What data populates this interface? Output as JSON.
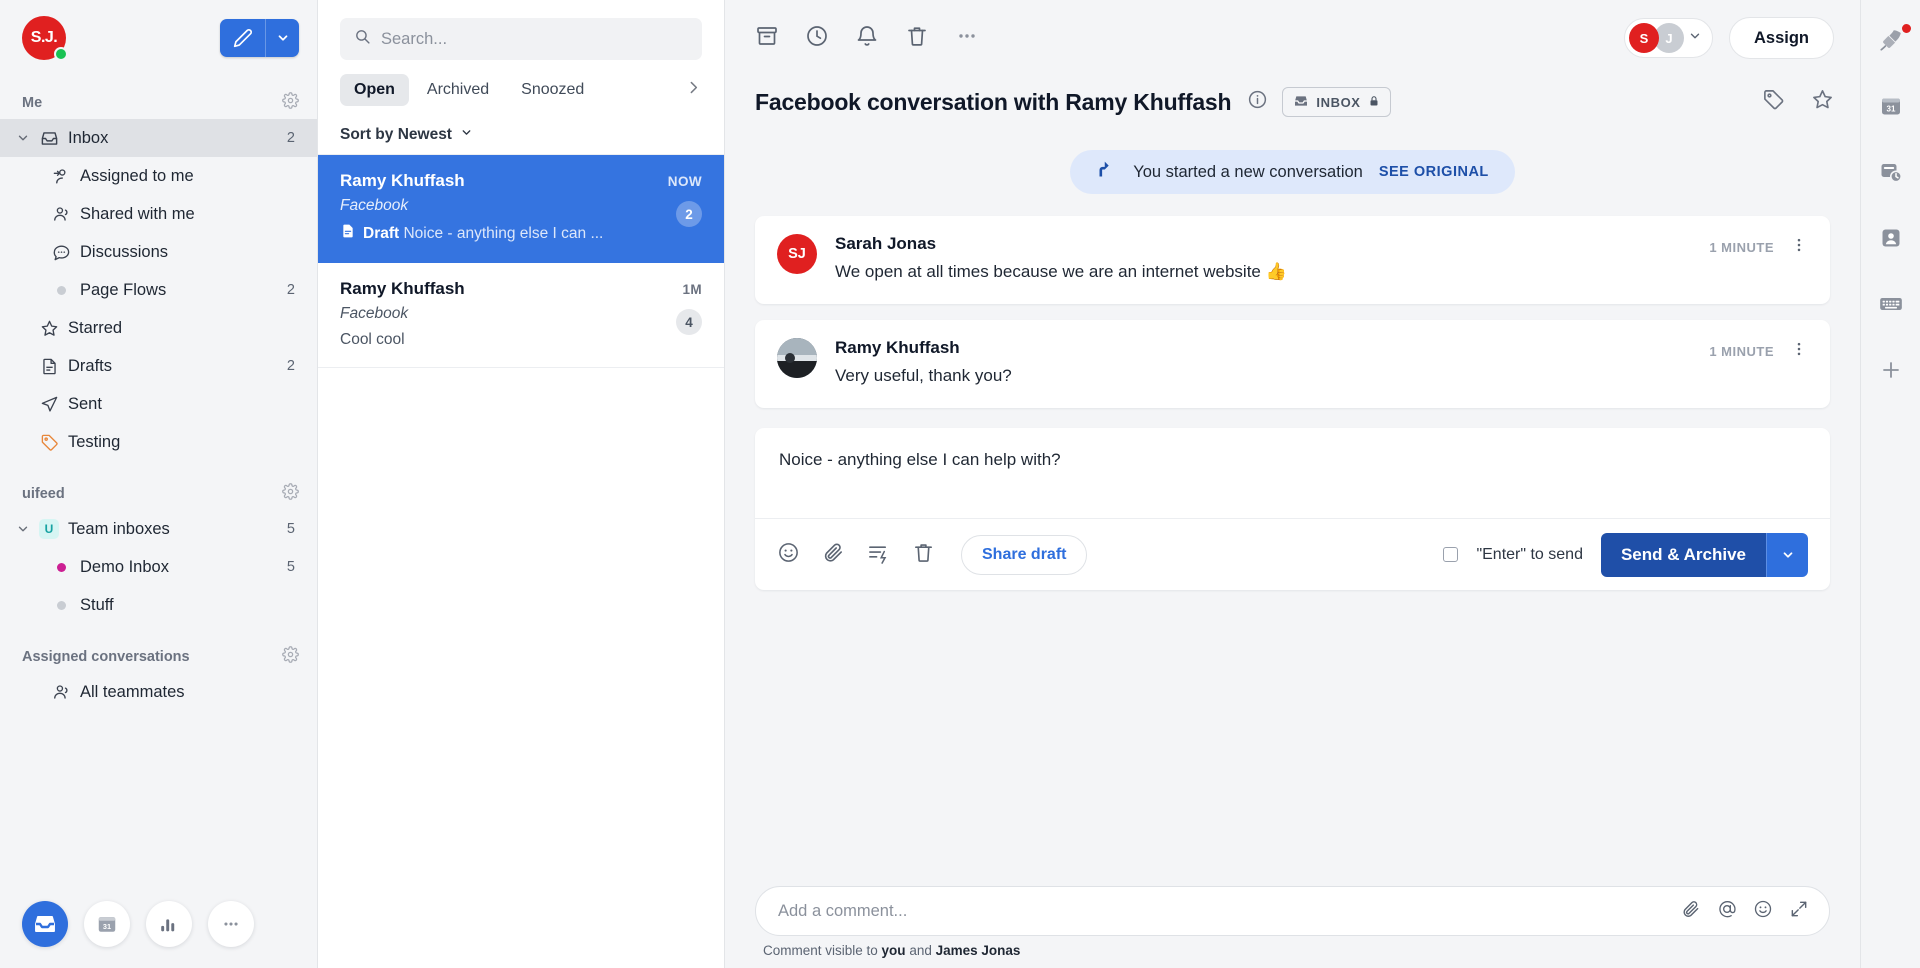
{
  "sidebar": {
    "user_initials": "S.J.",
    "sections": [
      {
        "title": "Me"
      },
      {
        "title": "uifeed"
      },
      {
        "title": "Assigned conversations"
      }
    ],
    "me_items": [
      {
        "label": "Inbox",
        "count": "2",
        "icon": "inbox-icon",
        "selected": true
      },
      {
        "label": "Assigned to me",
        "count": "",
        "icon": "assigned-icon"
      },
      {
        "label": "Shared with me",
        "count": "",
        "icon": "people-icon"
      },
      {
        "label": "Discussions",
        "count": "",
        "icon": "chat-icon"
      },
      {
        "label": "Page Flows",
        "count": "2",
        "icon": "dot-icon"
      },
      {
        "label": "Starred",
        "count": "",
        "icon": "star-icon"
      },
      {
        "label": "Drafts",
        "count": "2",
        "icon": "draft-icon"
      },
      {
        "label": "Sent",
        "count": "",
        "icon": "sent-icon"
      },
      {
        "label": "Testing",
        "count": "",
        "icon": "tag-icon"
      }
    ],
    "team_items": [
      {
        "label": "Team inboxes",
        "count": "5",
        "icon": "u-badge"
      },
      {
        "label": "Demo Inbox",
        "count": "5",
        "icon": "dot-icon",
        "dot_color": "#cc1f93"
      },
      {
        "label": "Stuff",
        "count": "",
        "icon": "dot-icon",
        "dot_color": "#c9cdd3"
      }
    ],
    "assigned_items": [
      {
        "label": "All teammates",
        "count": "",
        "icon": "people-icon"
      }
    ],
    "dock": [
      {
        "name": "inbox-app",
        "active": true
      },
      {
        "name": "calendar-app",
        "active": false
      },
      {
        "name": "reports-app",
        "active": false
      },
      {
        "name": "more-app",
        "active": false
      }
    ]
  },
  "list": {
    "search_placeholder": "Search...",
    "tabs": [
      {
        "label": "Open",
        "active": true
      },
      {
        "label": "Archived",
        "active": false
      },
      {
        "label": "Snoozed",
        "active": false
      }
    ],
    "sort_label": "Sort by Newest",
    "conversations": [
      {
        "name": "Ramy Khuffash",
        "time": "NOW",
        "channel": "Facebook",
        "prefix": "Draft",
        "snippet": "Noice - anything else I can ...",
        "badge": "2",
        "selected": true
      },
      {
        "name": "Ramy Khuffash",
        "time": "1M",
        "channel": "Facebook",
        "prefix": "",
        "snippet": "Cool cool",
        "badge": "4",
        "selected": false
      }
    ]
  },
  "main": {
    "title": "Facebook conversation with Ramy Khuffash",
    "inbox_chip": "INBOX",
    "assign_label": "Assign",
    "assignee_initials": [
      "S",
      "J"
    ],
    "banner": {
      "text": "You started a new conversation",
      "link": "SEE ORIGINAL"
    },
    "messages": [
      {
        "author": "Sarah Jonas",
        "initials": "SJ",
        "avatar_color": "#e02020",
        "text": "We open at all times because we are an internet website 👍",
        "time": "1 MINUTE"
      },
      {
        "author": "Ramy Khuffash",
        "initials": "",
        "avatar_color": "#3c4350",
        "text": "Very useful, thank you?",
        "time": "1 MINUTE"
      }
    ],
    "composer": {
      "draft_text": "Noice - anything else I can help with?",
      "share_draft_label": "Share draft",
      "enter_to_send_label": "\"Enter\" to send",
      "send_label": "Send & Archive"
    },
    "comment": {
      "placeholder": "Add a comment...",
      "note_prefix": "Comment visible to ",
      "note_you": "you",
      "note_and": " and ",
      "note_person": "James Jonas"
    }
  },
  "rail": [
    {
      "name": "rocket-icon",
      "has_dot": true
    },
    {
      "name": "calendar-icon",
      "has_dot": false
    },
    {
      "name": "snooze-icon",
      "has_dot": false
    },
    {
      "name": "contact-icon",
      "has_dot": false
    },
    {
      "name": "keyboard-icon",
      "has_dot": false
    },
    {
      "name": "add-icon",
      "has_dot": false
    }
  ]
}
